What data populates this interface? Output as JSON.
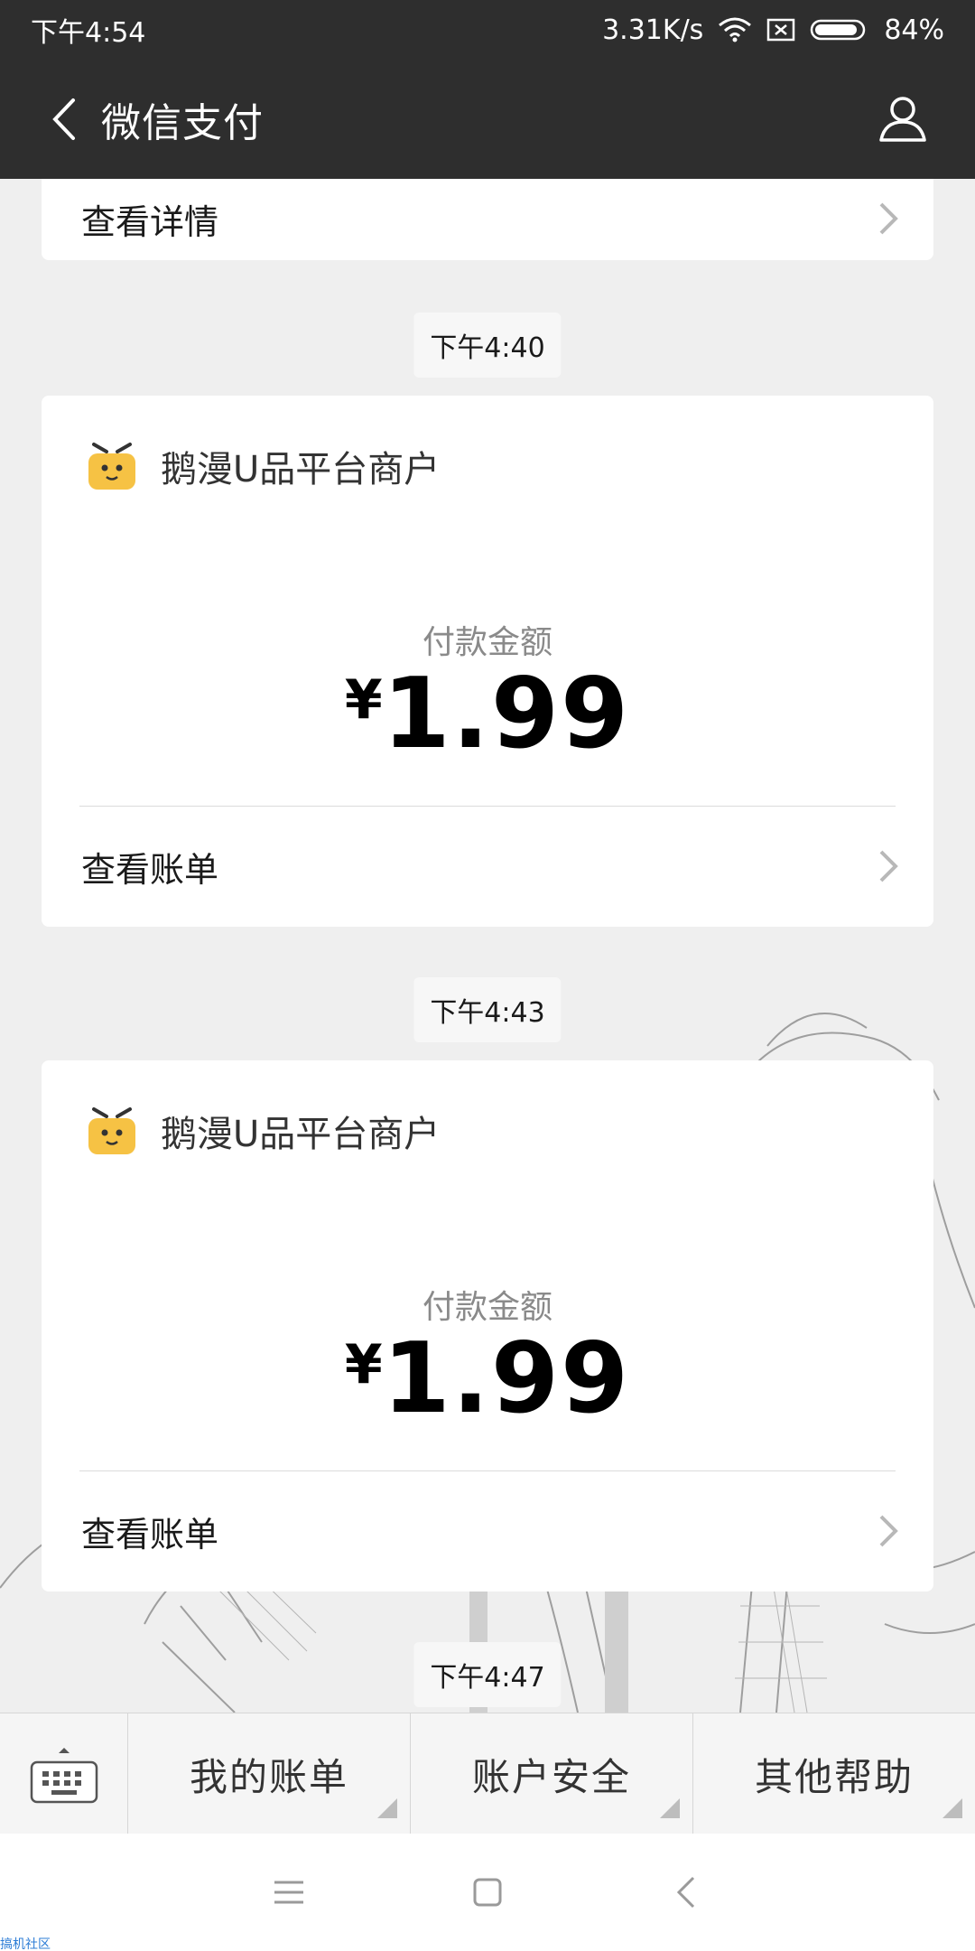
{
  "status_bar": {
    "time": "下午4:54",
    "speed": "3.31K/s",
    "battery": "84%",
    "icons": [
      "wifi-icon",
      "sim-icon",
      "battery-icon"
    ]
  },
  "header": {
    "title": "微信支付",
    "icons": [
      "back-arrow-icon",
      "user-profile-icon"
    ]
  },
  "chat": {
    "top_card": {
      "label": "查看详情"
    },
    "messages": [
      {
        "time": "下午4:40",
        "merchant": "鹅漫U品平台商户",
        "amount_label": "付款金额",
        "currency": "¥",
        "amount": "1.99",
        "bill_label": "查看账单"
      },
      {
        "time": "下午4:43",
        "merchant": "鹅漫U品平台商户",
        "amount_label": "付款金额",
        "currency": "¥",
        "amount": "1.99",
        "bill_label": "查看账单"
      }
    ],
    "last_time": "下午4:47"
  },
  "bottom_menu": {
    "items": [
      "我的账单",
      "账户安全",
      "其他帮助"
    ],
    "keyboard_icon": "keyboard-icon"
  },
  "nav_bar": {
    "icons": [
      "menu-icon",
      "home-icon",
      "back-icon"
    ]
  },
  "watermark": "搞机社区",
  "colors": {
    "bar": "#2e2e2e",
    "background": "#efefef",
    "card": "#ffffff",
    "merchant_logo": "#f6c244"
  }
}
